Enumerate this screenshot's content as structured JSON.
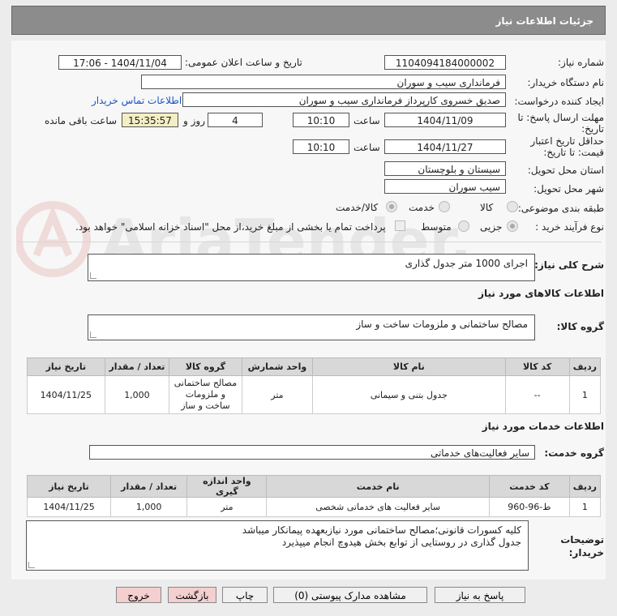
{
  "header": {
    "title": "جزئیات اطلاعات نیاز"
  },
  "form": {
    "need_number_label": "شماره نیاز:",
    "need_number": "1104094184000002",
    "announce_label": "تاریخ و ساعت اعلان عمومی:",
    "announce_value": "1404/11/04 - 17:06",
    "buyer_org_label": "نام دستگاه خریدار:",
    "buyer_org": "فرمانداری سیب و سوران",
    "creator_label": "ایجاد کننده درخواست:",
    "creator": "صدیق خسروی کارپرداز فرمانداری سیب و سوران",
    "contact_link": "اطلاعات تماس خریدار",
    "deadline_label": "مهلت ارسال پاسخ: تا تاریخ:",
    "deadline_date": "1404/11/09",
    "time_label": "ساعت",
    "deadline_time": "10:10",
    "days_value": "4",
    "days_label": "روز و",
    "remaining_time": "15:35:57",
    "remaining_label": "ساعت باقی مانده",
    "validity_label": "حداقل تاریخ اعتبار قیمت: تا تاریخ:",
    "validity_date": "1404/11/27",
    "validity_time": "10:10",
    "province_label": "استان محل تحویل:",
    "province": "سیستان و بلوچستان",
    "city_label": "شهر محل تحویل:",
    "city": "سیب سوران",
    "category_label": "طبقه بندی موضوعی:",
    "category_options": [
      "کالا",
      "خدمت",
      "کالا/خدمت"
    ],
    "category_selected": "کالا/خدمت",
    "process_label": "نوع فرآیند خرید :",
    "process_options": [
      "جزیی",
      "متوسط"
    ],
    "process_selected": "جزیی",
    "payment_note": "پرداخت تمام یا بخشی از مبلغ خرید،از محل \"اسناد خزانه اسلامی\" خواهد بود."
  },
  "description": {
    "label": "شرح کلی نیاز:",
    "value": "اجرای 1000 متر جدول گذاری"
  },
  "goods": {
    "section_title": "اطلاعات کالاهای مورد نیاز",
    "group_label": "گروه کالا:",
    "group_value": "مصالح ساختمانی و ملزومات ساخت و ساز",
    "headers": [
      "ردیف",
      "کد کالا",
      "نام کالا",
      "واحد شمارش",
      "گروه کالا",
      "تعداد / مقدار",
      "تاریخ نیاز"
    ],
    "rows": [
      {
        "row": "1",
        "code": "--",
        "name": "جدول بتنی و سیمانی",
        "unit": "متر",
        "group": "مصالح ساختمانی و ملزومات ساخت و ساز",
        "qty": "1,000",
        "date": "1404/11/25"
      }
    ]
  },
  "services": {
    "section_title": "اطلاعات خدمات مورد نیاز",
    "group_label": "گروه خدمت:",
    "group_value": "سایر فعالیت‌های خدماتی",
    "headers": [
      "ردیف",
      "کد خدمت",
      "نام خدمت",
      "واحد اندازه گیری",
      "تعداد / مقدار",
      "تاریخ نیاز"
    ],
    "rows": [
      {
        "row": "1",
        "code": "ط-96-960",
        "name": "سایر فعالیت های خدماتی شخصی",
        "unit": "متر",
        "qty": "1,000",
        "date": "1404/11/25"
      }
    ]
  },
  "notes": {
    "label": "توضیحات خریدار:",
    "line1": "کلیه کسورات قانونی؛مصالح ساختمانی مورد نیازبعهده پیمانکار میباشد",
    "line2": "جدول گذاری در روستایی از توابع بخش هیدوچ انجام میپذیرد"
  },
  "buttons": {
    "reply": "پاسخ به نیاز",
    "attachments": "مشاهده مدارک پیوستی (0)",
    "print": "چاپ",
    "back": "بازگشت",
    "exit": "خروج"
  },
  "watermark": {
    "text": "AriaTender.net"
  },
  "colors": {
    "header": "#8c8c8c",
    "link": "#1a55c4",
    "highlight": "#f3eec4",
    "pink_button": "#f4cfcf"
  }
}
